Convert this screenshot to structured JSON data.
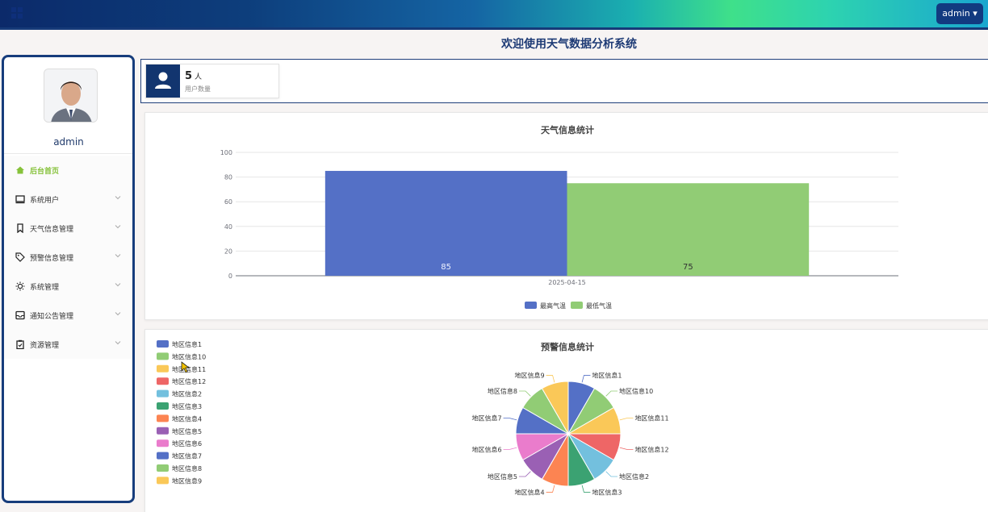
{
  "header": {
    "user_menu_label": "admin"
  },
  "page_title": "欢迎使用天气数据分析系统",
  "sidebar": {
    "username": "admin",
    "items": [
      {
        "label": "后台首页",
        "icon": "home-icon",
        "active": true
      },
      {
        "label": "系统用户",
        "icon": "monitor-icon"
      },
      {
        "label": "天气信息管理",
        "icon": "bookmark-icon"
      },
      {
        "label": "预警信息管理",
        "icon": "tag-icon"
      },
      {
        "label": "系统管理",
        "icon": "sun-icon"
      },
      {
        "label": "通知公告管理",
        "icon": "inbox-icon"
      },
      {
        "label": "资源管理",
        "icon": "clipboard-icon"
      }
    ]
  },
  "stats": {
    "user_count": "5",
    "user_unit": "人",
    "user_label": "用户数量"
  },
  "colors": {
    "accent": "#173d7c",
    "active_menu": "#86c23a"
  },
  "chart_data": [
    {
      "type": "bar",
      "title": "天气信息统计",
      "categories": [
        "2025-04-15"
      ],
      "series": [
        {
          "name": "最高气温",
          "values": [
            85
          ],
          "color": "#5470c6"
        },
        {
          "name": "最低气温",
          "values": [
            75
          ],
          "color": "#91cc75"
        }
      ],
      "ylim": [
        0,
        100
      ],
      "yticks": [
        0,
        20,
        40,
        60,
        80,
        100
      ],
      "grid": true,
      "legend": "bottom-center"
    },
    {
      "type": "pie",
      "title": "预警信息统计",
      "legend": "top-left",
      "labels": [
        "地区信息1",
        "地区信息10",
        "地区信息11",
        "地区信息12",
        "地区信息2",
        "地区信息3",
        "地区信息4",
        "地区信息5",
        "地区信息6",
        "地区信息7",
        "地区信息8",
        "地区信息9"
      ],
      "values": [
        1,
        1,
        1,
        1,
        1,
        1,
        1,
        1,
        1,
        1,
        1,
        1
      ],
      "colors": [
        "#5470c6",
        "#91cc75",
        "#fac858",
        "#ee6666",
        "#73c0de",
        "#3ba272",
        "#fc8452",
        "#9a60b4",
        "#ea7ccc",
        "#5470c6",
        "#91cc75",
        "#fac858"
      ]
    }
  ]
}
